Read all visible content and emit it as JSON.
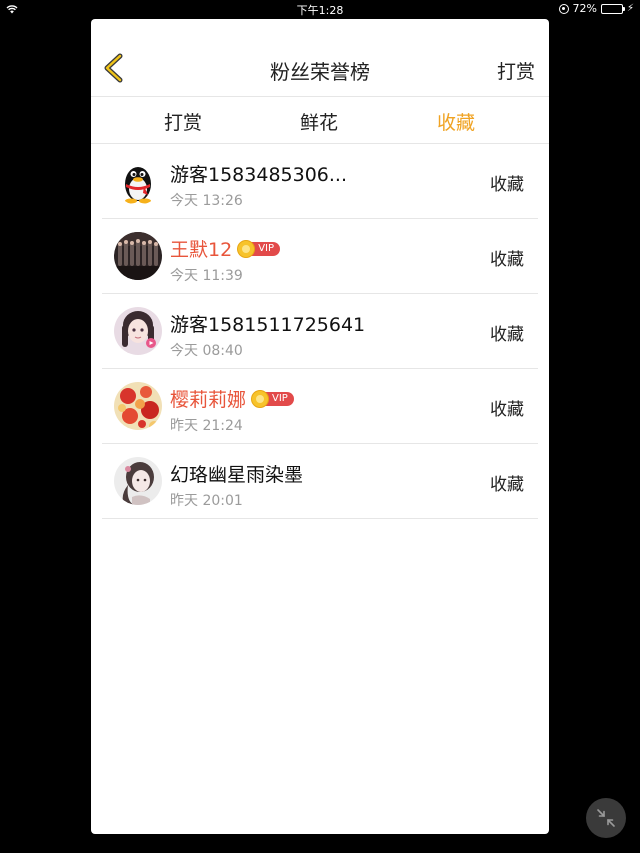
{
  "status_bar": {
    "time": "下午1:28",
    "battery": "72%",
    "battery_level": 0.72
  },
  "header": {
    "title": "粉丝荣誉榜",
    "right_action": "打赏"
  },
  "tabs": [
    {
      "label": "打赏",
      "active": false
    },
    {
      "label": "鲜花",
      "active": false
    },
    {
      "label": "收藏",
      "active": true
    }
  ],
  "accent_color": "#f0a323",
  "vip_name_color": "#e8553b",
  "vip_label": "VIP",
  "rows": [
    {
      "name": "游客1583485306...",
      "time": "今天 13:26",
      "action": "收藏",
      "vip": false,
      "avatar": "qq-penguin-avatar"
    },
    {
      "name": "王默12",
      "time": "今天 11:39",
      "action": "收藏",
      "vip": true,
      "avatar": "group-photo-avatar"
    },
    {
      "name": "游客1581511725641",
      "time": "今天 08:40",
      "action": "收藏",
      "vip": false,
      "avatar": "anime-girl-avatar"
    },
    {
      "name": "樱莉莉娜",
      "time": "昨天 21:24",
      "action": "收藏",
      "vip": true,
      "avatar": "flowers-avatar"
    },
    {
      "name": "幻珞幽星雨染墨",
      "time": "昨天 20:01",
      "action": "收藏",
      "vip": false,
      "avatar": "girl-portrait-avatar"
    }
  ]
}
